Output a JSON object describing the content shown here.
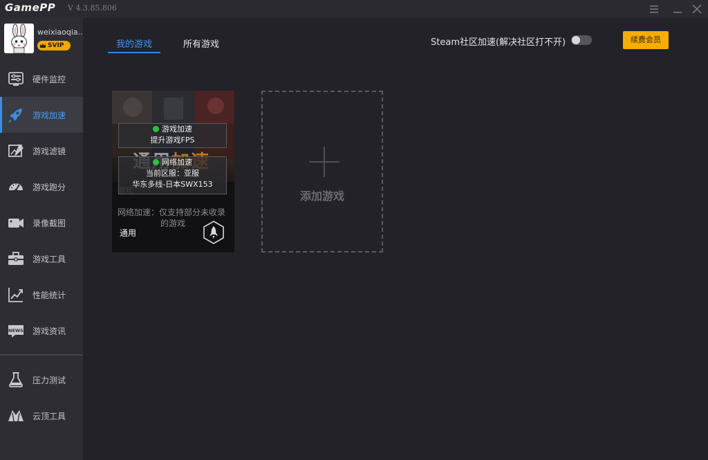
{
  "app": {
    "logo": "GamePP",
    "version": "V 4.3.85.806"
  },
  "window": {
    "menu_icon": "hamburger-icon",
    "minimize_icon": "minimize-icon",
    "close_icon": "close-icon"
  },
  "profile": {
    "username": "weixiaoqia..",
    "badge": "SVIP"
  },
  "sidebar": {
    "items": [
      {
        "label": "硬件监控",
        "icon": "hardware-monitor-icon"
      },
      {
        "label": "游戏加速",
        "icon": "rocket-icon",
        "active": true
      },
      {
        "label": "游戏滤镜",
        "icon": "filter-icon"
      },
      {
        "label": "游戏跑分",
        "icon": "speedometer-icon"
      },
      {
        "label": "录像截图",
        "icon": "camera-icon"
      },
      {
        "label": "游戏工具",
        "icon": "toolbox-icon"
      },
      {
        "label": "性能统计",
        "icon": "chart-icon"
      },
      {
        "label": "游戏资讯",
        "icon": "news-icon"
      }
    ],
    "bottom_items": [
      {
        "label": "压力测试",
        "icon": "flask-icon"
      },
      {
        "label": "云顶工具",
        "icon": "mountain-icon"
      }
    ]
  },
  "tabs": [
    {
      "label": "我的游戏",
      "active": true
    },
    {
      "label": "所有游戏",
      "active": false
    }
  ],
  "steam": {
    "label": "Steam社区加速(解决社区打不开)",
    "enabled": false
  },
  "renew_button": "续费会员",
  "game_card": {
    "title_main": "通用",
    "title_accent": "加速",
    "status1": {
      "line1": "游戏加速",
      "line2": "提升游戏FPS"
    },
    "status2": {
      "line1": "网络加速",
      "line2": "当前区服：亚服",
      "line3": "华东多线-日本SWX153"
    },
    "ghost_text": "游戏",
    "note_line1": "网络加速：仅支持部分未收录",
    "note_line2": "的游戏",
    "tag": "通用",
    "status_color": "#29c43c"
  },
  "add_game": {
    "label": "添加游戏"
  },
  "colors": {
    "accent": "#3a8ee6",
    "vip": "#f5ad00",
    "background": "#222228",
    "sidebar": "#2d2d33"
  }
}
